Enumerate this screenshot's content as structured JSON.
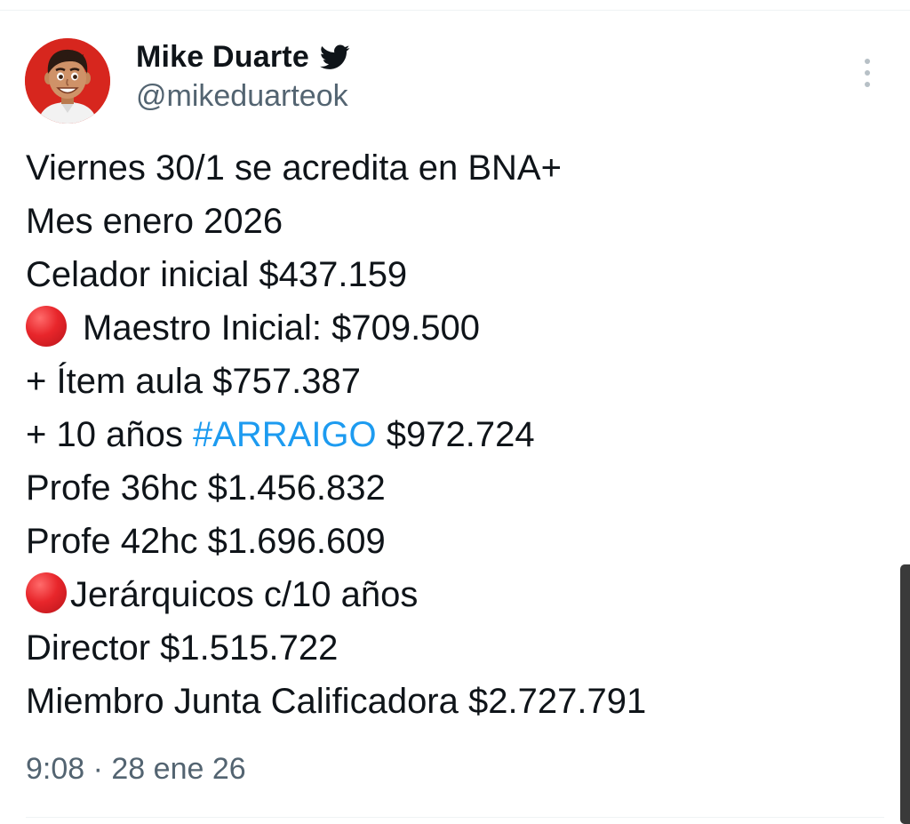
{
  "author": {
    "name": "Mike Duarte",
    "handle": "@mikeduarteok",
    "verified_icon": "twitter-bird-icon",
    "avatar": "cartoon-avatar"
  },
  "tweet": {
    "lines": [
      {
        "text": "Viernes 30/1 se acredita en BNA+"
      },
      {
        "text": "Mes enero 2026"
      },
      {
        "text": "Celador inicial $437.159"
      },
      {
        "icon": "red-circle",
        "text": "Maestro Inicial: $709.500"
      },
      {
        "text": "+ Ítem aula $757.387"
      },
      {
        "prefix": "+ 10 años ",
        "hashtag": "#ARRAIGO",
        "suffix": " $972.724"
      },
      {
        "text": "Profe 36hc $1.456.832"
      },
      {
        "text": "Profe 42hc $1.696.609"
      },
      {
        "icon": "red-circle",
        "text": "Jerárquicos c/10 años"
      },
      {
        "text": "Director $1.515.722"
      },
      {
        "text": "Miembro Junta Calificadora $2.727.791"
      }
    ],
    "timestamp": "9:08 · 28 ene 26"
  },
  "colors": {
    "text": "#0f1419",
    "secondary": "#536471",
    "hashtag": "#1d9bf0",
    "twitter_icon": "#0f1419",
    "emoji_red": "#e8262b",
    "avatar_bg": "#d7261e"
  },
  "more_menu_icon": "vertical-dots-icon"
}
